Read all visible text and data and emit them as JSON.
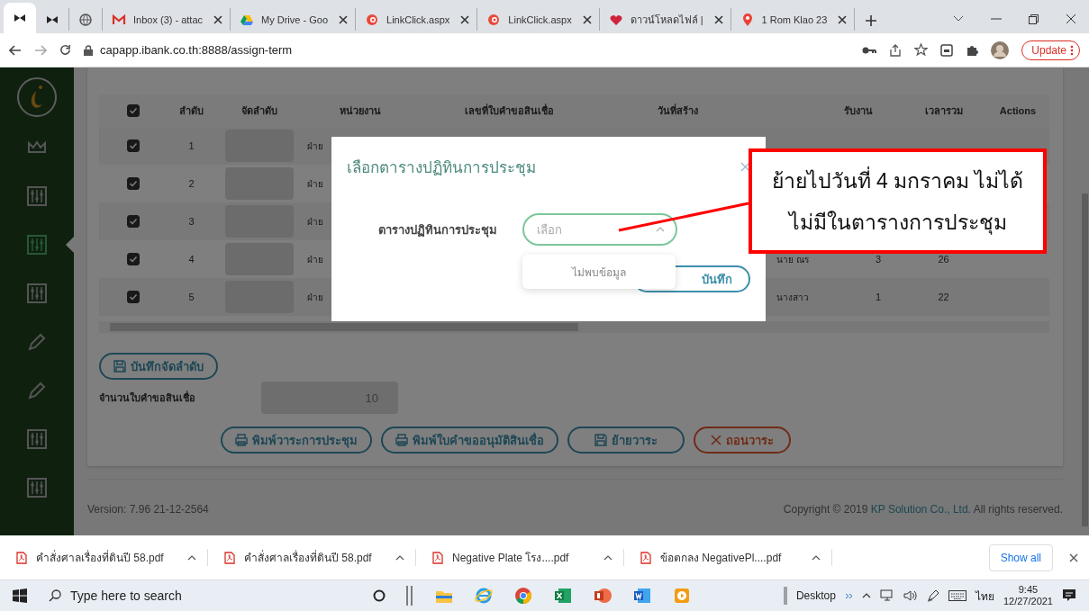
{
  "browser": {
    "tabs": [
      {
        "kind": "pinned",
        "selected": true
      },
      {
        "kind": "pinned",
        "selected": false
      },
      {
        "kind": "globe",
        "selected": false
      },
      {
        "kind": "mail",
        "title": "Inbox (3) - attac",
        "selected": false
      },
      {
        "kind": "drive",
        "title": "My Drive - Goo",
        "selected": false
      },
      {
        "kind": "link",
        "title": "LinkClick.aspx",
        "selected": false
      },
      {
        "kind": "link",
        "title": "LinkClick.aspx",
        "selected": false
      },
      {
        "kind": "heart",
        "title": "ดาวน์โหลดไฟล์ |",
        "selected": false
      },
      {
        "kind": "pin",
        "title": "1 Rom Klao 23",
        "selected": false
      }
    ],
    "address": "capapp.ibank.co.th:8888/assign-term",
    "update_button": "Update"
  },
  "sidebar": {
    "items": [
      {
        "kind": "crown",
        "selected": false
      },
      {
        "kind": "mixer",
        "selected": false
      },
      {
        "kind": "mixer",
        "selected": true
      },
      {
        "kind": "mixer",
        "selected": false
      },
      {
        "kind": "pencil",
        "selected": false
      },
      {
        "kind": "pencil",
        "selected": false
      },
      {
        "kind": "mixer",
        "selected": false
      },
      {
        "kind": "mixer",
        "selected": false
      }
    ]
  },
  "table": {
    "columns": [
      {
        "kind": "check",
        "checked": true
      },
      {
        "kind": "text",
        "label": "ลำดับ"
      },
      {
        "kind": "text",
        "label": "จัดลำดับ"
      },
      {
        "kind": "text",
        "label": "หน่วยงาน"
      },
      {
        "kind": "text",
        "label": "เลขที่ใบคำขอสินเชื่อ"
      },
      {
        "kind": "text",
        "label": "วันที่สร้าง"
      },
      {
        "kind": "blank"
      },
      {
        "kind": "text",
        "label": "รับงาน"
      },
      {
        "kind": "text",
        "label": "เวลารวม"
      },
      {
        "kind": "text",
        "label": "Actions"
      }
    ],
    "rows": [
      {
        "checked": true,
        "number": "1",
        "unit": "ฝ่าย"
      },
      {
        "checked": true,
        "number": "2",
        "unit": "ฝ่าย"
      },
      {
        "checked": true,
        "number": "3",
        "unit": "ฝ่าย"
      },
      {
        "checked": true,
        "number": "4",
        "unit": "ฝ่าย",
        "name": "นาย ณร",
        "received": "3",
        "total_time": "26"
      },
      {
        "checked": true,
        "number": "5",
        "unit": "ฝ่าย",
        "name": "นางสาว",
        "received": "1",
        "total_time": "22"
      }
    ]
  },
  "save_order_button": "บันทึกจัดลำดับ",
  "count": {
    "label": "จำนวนใบคำขอสินเชื่อ",
    "value": "10"
  },
  "actions": [
    {
      "kind": "print",
      "label": "พิมพ์วาระการประชุม"
    },
    {
      "kind": "print",
      "label": "พิมพ์ใบคำขออนุมัติสินเชื่อ"
    },
    {
      "kind": "save",
      "label": "ย้ายวาระ"
    },
    {
      "kind": "cancel",
      "label": "ถอนวาระ"
    }
  ],
  "footer": {
    "version": "Version: 7.96 21-12-2564",
    "copyright": "Copyright © 2019",
    "company": "KP Solution Co., Ltd.",
    "rights": "All rights reserved."
  },
  "modal": {
    "title": "เลือกตารางปฏิทินการประชุม",
    "field_label": "ตารางปฏิทินการประชุม",
    "placeholder": "เลือก",
    "expanded": true,
    "dropdown_message": "ไม่พบข้อมูล",
    "save_button": "บันทึก"
  },
  "annotation": {
    "lines": [
      "ย้ายไปวันที่ 4 มกราคม ไม่ได้",
      "ไม่มีในตารางการประชุม"
    ]
  },
  "downloads": {
    "items": [
      {
        "name": "คำสั่งศาลเรื่องที่ดินปี 58.pdf"
      },
      {
        "name": "คำสั่งศาลเรื่องที่ดินปี 58.pdf"
      },
      {
        "name": "Negative Plate โรง....pdf"
      },
      {
        "name": "ข้อตกลง NegativePl....pdf"
      }
    ],
    "show_all": "Show all"
  },
  "taskbar": {
    "search_placeholder": "Type here to search",
    "apps": [
      {
        "kind": "explorer"
      },
      {
        "kind": "ie"
      },
      {
        "kind": "chrome"
      },
      {
        "kind": "excel"
      },
      {
        "kind": "powerpoint"
      },
      {
        "kind": "word"
      },
      {
        "kind": "media"
      }
    ],
    "desktop": "Desktop",
    "language": "ไทย",
    "time": "9:45",
    "date": "12/27/2021"
  }
}
